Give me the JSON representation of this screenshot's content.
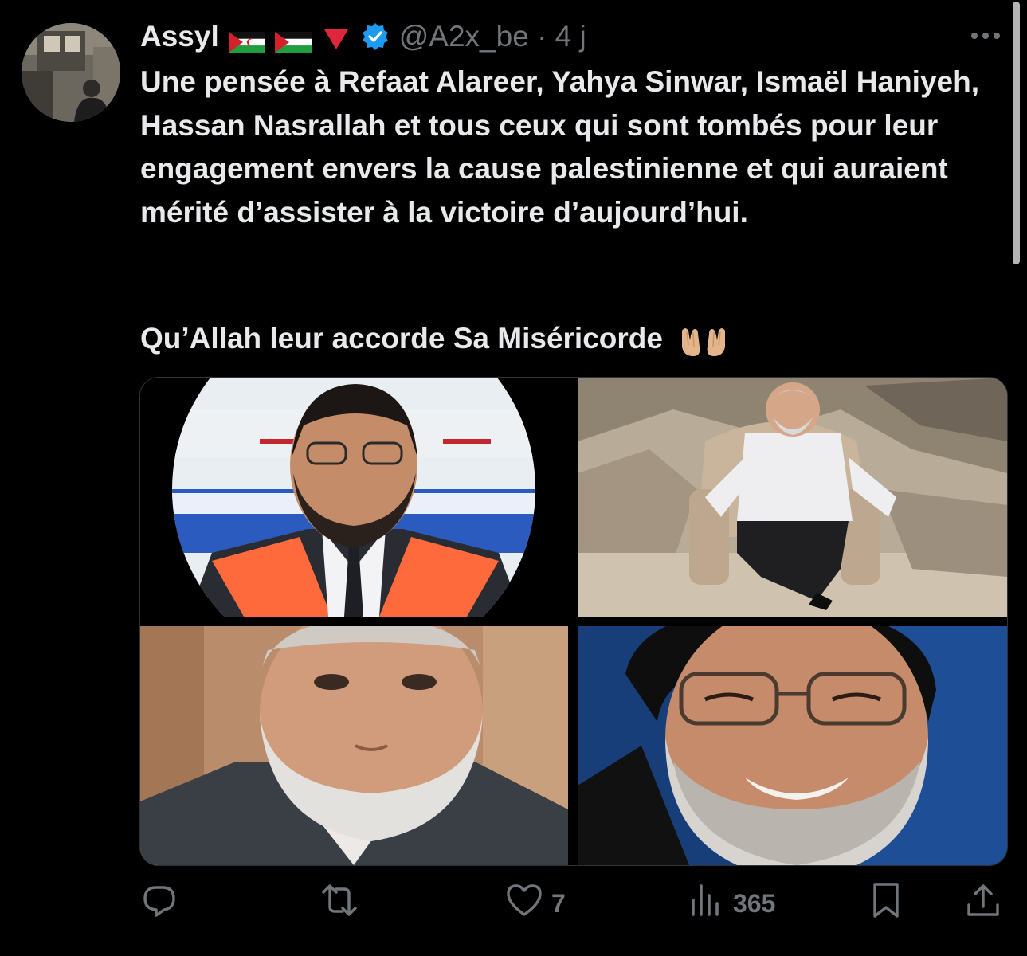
{
  "tweet": {
    "author_name": "Assyl",
    "handle_time": "@A2x_be · 4 j",
    "badges": [
      "western-sahara-flag-icon",
      "palestine-flag-icon",
      "red-triangle-icon",
      "verified-badge-icon"
    ],
    "text": "Une pensée à Refaat Alareer, Yahya Sinwar, Ismaël Haniyeh, Hassan Nasrallah et tous ceux qui sont tombés pour leur engagement envers la cause palestinienne et qui auraient mérité d’assister à la victoire d’aujourd’hui.",
    "closing": "Qu’Allah leur accorde Sa Miséricorde",
    "closing_emoji": "palms-up-together-icon",
    "media": [
      {
        "name": "photo-1-portrait-graduation-gown"
      },
      {
        "name": "photo-2-man-seated-armchair-rubble"
      },
      {
        "name": "photo-3-portrait-white-beard"
      },
      {
        "name": "photo-4-portrait-smiling-glasses"
      }
    ]
  },
  "actions": {
    "reply": {
      "icon": "reply-icon",
      "count": ""
    },
    "repost": {
      "icon": "repost-icon",
      "count": ""
    },
    "like": {
      "icon": "heart-icon",
      "count": "7"
    },
    "views": {
      "icon": "views-icon",
      "count": "365"
    },
    "bookmark": {
      "icon": "bookmark-icon"
    },
    "share": {
      "icon": "share-icon"
    }
  },
  "colors": {
    "background": "#000000",
    "text_primary": "#e7e9ea",
    "text_secondary": "#71767b",
    "verified_blue": "#1d9bf0"
  }
}
